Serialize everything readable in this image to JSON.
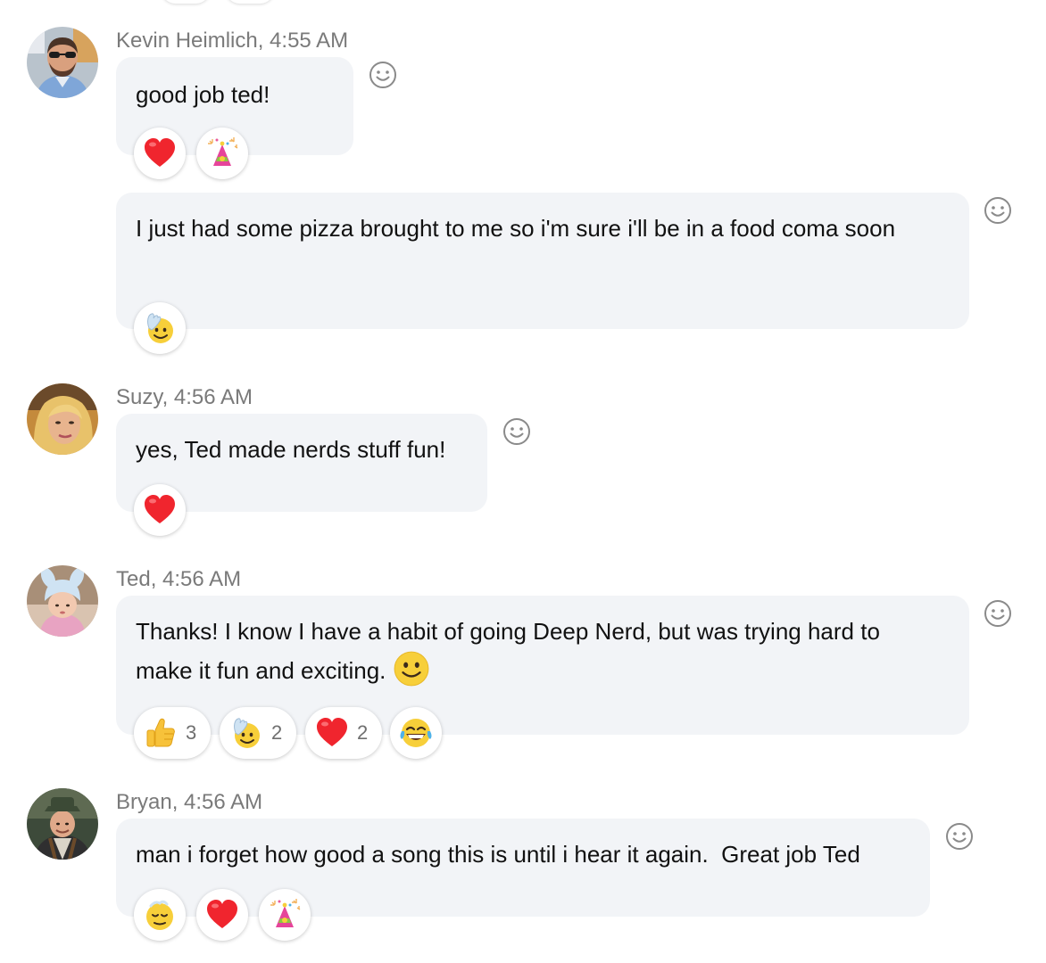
{
  "messages": [
    {
      "sender": "Kevin Heimlich, 4:55 AM",
      "bubbles": [
        {
          "text": "good job ted!",
          "reactions": [
            {
              "icon": "heart"
            },
            {
              "icon": "party-hat"
            }
          ]
        },
        {
          "text": "I just had some pizza brought to me so i'm sure i'll be in a food coma soon",
          "reactions": [
            {
              "icon": "waving-face"
            }
          ]
        }
      ]
    },
    {
      "sender": "Suzy, 4:56 AM",
      "bubbles": [
        {
          "text": "yes, Ted made nerds stuff fun!",
          "reactions": [
            {
              "icon": "heart"
            }
          ]
        }
      ]
    },
    {
      "sender": "Ted, 4:56 AM",
      "bubbles": [
        {
          "text": "Thanks! I know I have a habit of going Deep Nerd, but was trying hard to make it fun and exciting.",
          "inline_emoji": "smiley",
          "reactions": [
            {
              "icon": "thumbs-up",
              "count": "3"
            },
            {
              "icon": "waving-face",
              "count": "2"
            },
            {
              "icon": "heart",
              "count": "2"
            },
            {
              "icon": "tears-of-joy"
            }
          ]
        }
      ]
    },
    {
      "sender": "Bryan, 4:56 AM",
      "bubbles": [
        {
          "text": "man i forget how good a song this is until i hear it again.  Great job Ted",
          "reactions": [
            {
              "icon": "bowing-face"
            },
            {
              "icon": "heart"
            },
            {
              "icon": "party-hat"
            }
          ]
        }
      ]
    }
  ],
  "colors": {
    "bubble": "#f2f4f7",
    "heart": "#f0252e",
    "meta": "#7a7a7a",
    "emoji_yellow": "#f7cf3a"
  }
}
